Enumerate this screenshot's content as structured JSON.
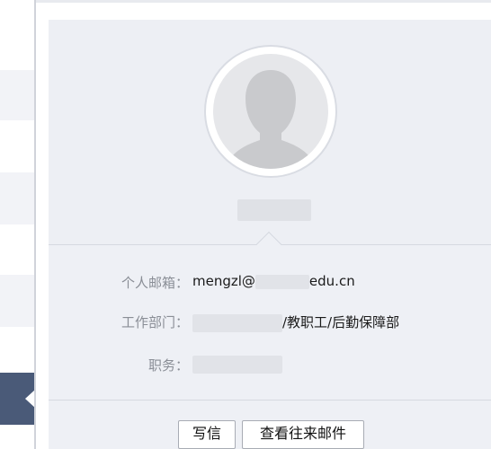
{
  "profile": {
    "email_label": "个人邮箱：",
    "email_prefix": "mengzl@",
    "email_suffix": "edu.cn",
    "dept_label": "工作部门：",
    "dept_value": "/教职工/后勤保障部",
    "title_label": "职务："
  },
  "actions": {
    "write_label": "写信",
    "history_label": "查看往来邮件"
  },
  "colors": {
    "card_bg": "#eef0f5",
    "selected_row": "#4a5a78",
    "label_text": "#8a8e96"
  }
}
